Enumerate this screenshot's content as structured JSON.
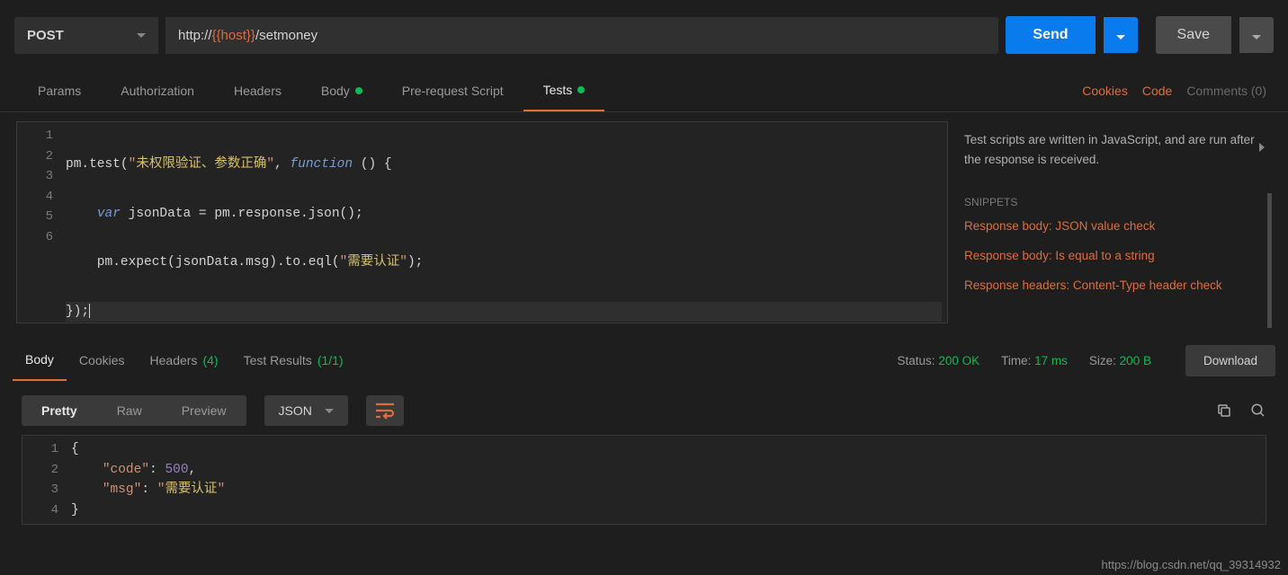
{
  "request": {
    "method": "POST",
    "url_prefix": "http://",
    "url_var": "{{host}}",
    "url_suffix": "/setmoney",
    "send_label": "Send",
    "save_label": "Save"
  },
  "req_tabs": {
    "params": "Params",
    "authorization": "Authorization",
    "headers": "Headers",
    "body": "Body",
    "prerequest": "Pre-request Script",
    "tests": "Tests"
  },
  "right_links": {
    "cookies": "Cookies",
    "code": "Code",
    "comments": "Comments (0)"
  },
  "editor": {
    "lines": [
      "1",
      "2",
      "3",
      "4",
      "5",
      "6"
    ],
    "l1a": "pm.test(",
    "l1b": "\"",
    "l1c": "未权限验证、参数正确",
    "l1d": "\"",
    "l1e": ", ",
    "l1f": "function",
    "l1g": " () {",
    "l2a": "    ",
    "l2b": "var",
    "l2c": " jsonData = pm.response.json();",
    "l3a": "    pm.expect(jsonData.msg).to.eql(",
    "l3b": "\"",
    "l3c": "需要认证",
    "l3d": "\"",
    "l3e": ");",
    "l4": "});"
  },
  "side": {
    "desc": "Test scripts are written in JavaScript, and are run after the response is received.",
    "snippets_header": "SNIPPETS",
    "snip1": "Response body: JSON value check",
    "snip2": "Response body: Is equal to a string",
    "snip3": "Response headers: Content-Type header check"
  },
  "resp_tabs": {
    "body": "Body",
    "cookies": "Cookies",
    "headers": "Headers",
    "headers_count": "(4)",
    "testresults": "Test Results",
    "testresults_count": "(1/1)"
  },
  "resp_meta": {
    "status_label": "Status:",
    "status_value": "200 OK",
    "time_label": "Time:",
    "time_value": "17 ms",
    "size_label": "Size:",
    "size_value": "200 B",
    "download": "Download"
  },
  "view": {
    "pretty": "Pretty",
    "raw": "Raw",
    "preview": "Preview",
    "format": "JSON"
  },
  "resp_body": {
    "lines": [
      "1",
      "2",
      "3",
      "4"
    ],
    "l1": "{",
    "l2a": "    ",
    "l2b": "\"code\"",
    "l2c": ": ",
    "l2d": "500",
    "l2e": ",",
    "l3a": "    ",
    "l3b": "\"msg\"",
    "l3c": ": ",
    "l3d": "\"",
    "l3e": "需要认证",
    "l3f": "\"",
    "l4": "}"
  },
  "watermark": "https://blog.csdn.net/qq_39314932"
}
